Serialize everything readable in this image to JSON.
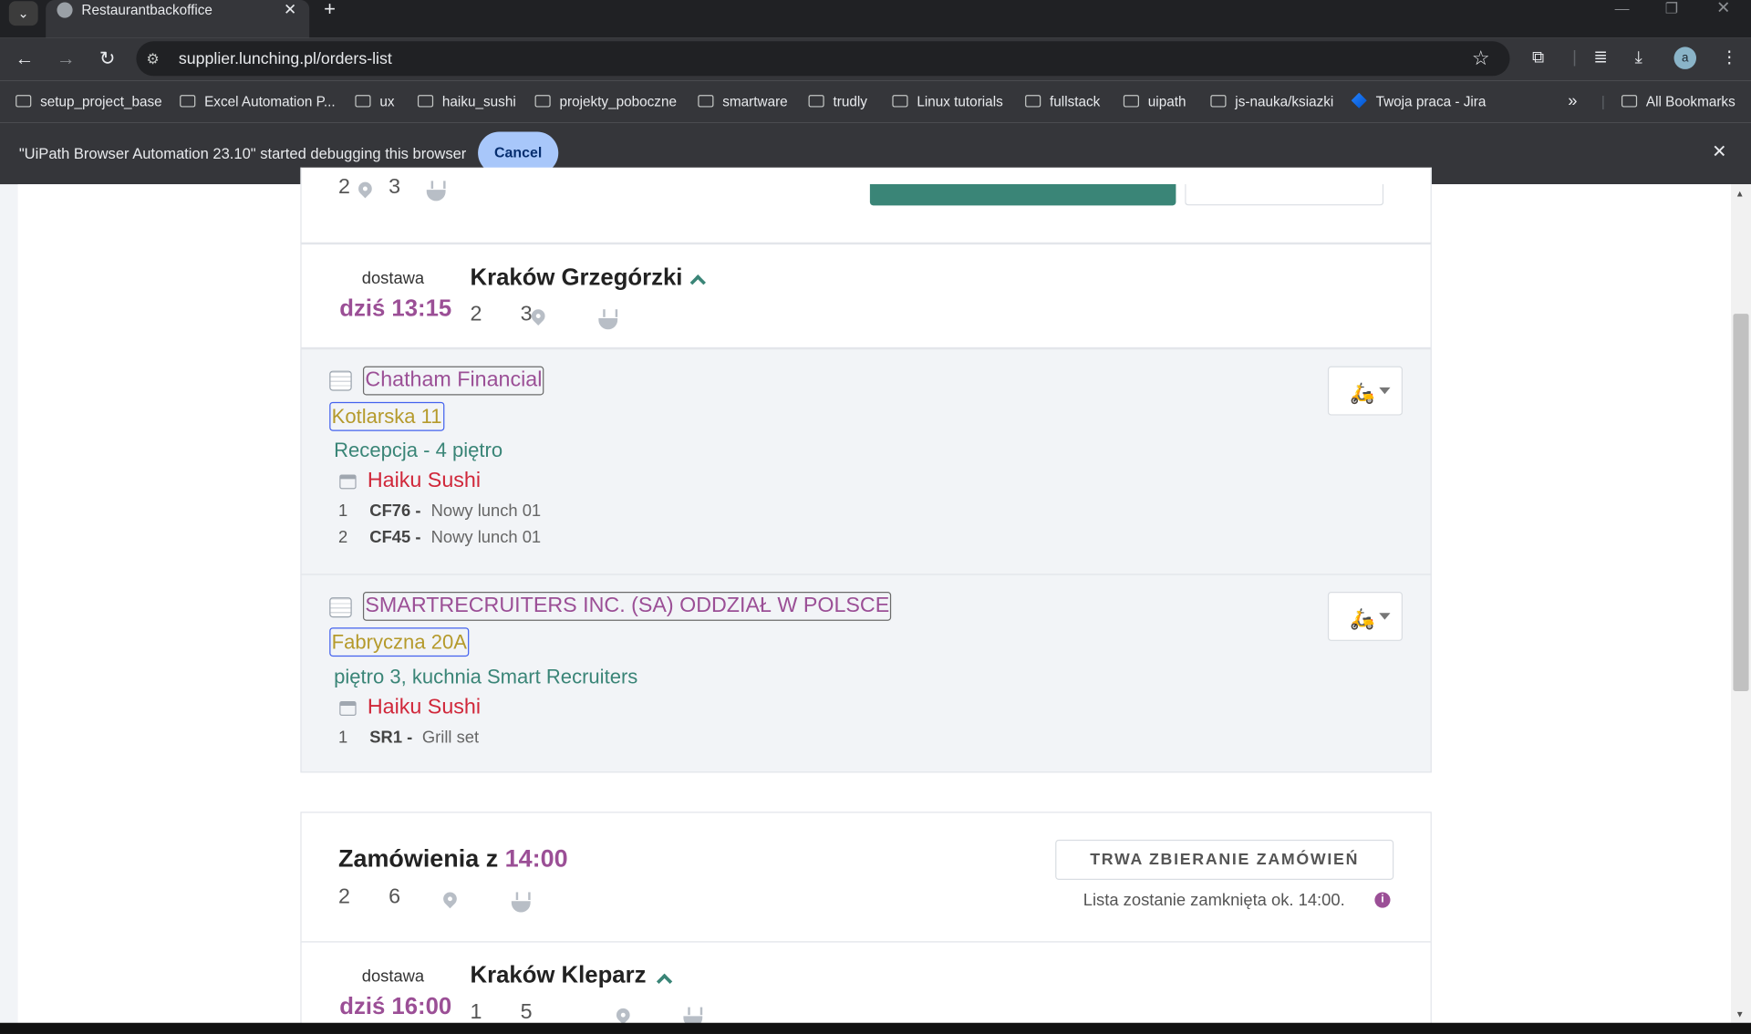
{
  "browser": {
    "tab_title": "Restaurantbackoffice",
    "url": "supplier.lunching.pl/orders-list",
    "avatar_letter": "a",
    "bookmarks": [
      "setup_project_base",
      "Excel Automation P...",
      "ux",
      "haiku_sushi",
      "projekty_poboczne",
      "smartware",
      "trudly",
      "Linux tutorials",
      "fullstack",
      "uipath",
      "js-nauka/ksiazki",
      "Twoja praca - Jira"
    ],
    "all_bookmarks": "All Bookmarks",
    "overflow": "»",
    "debug_message": "\"UiPath Browser Automation 23.10\" started debugging this browser",
    "cancel_label": "Cancel"
  },
  "top_partial": {
    "locations": "2",
    "meals": "3"
  },
  "delivery_groups": [
    {
      "label": "dostawa",
      "time": "dziś 13:15",
      "area": "Kraków Grzegórzki",
      "locations": "2",
      "meals": "3",
      "orders": [
        {
          "company": "Chatham Financial",
          "street": "Kotlarska 11",
          "place": "Recepcja - 4 piętro",
          "restaurant": "Haiku Sushi",
          "items": [
            {
              "qty": "1",
              "code": "CF76 -",
              "name": "Nowy lunch 01"
            },
            {
              "qty": "2",
              "code": "CF45 -",
              "name": "Nowy lunch 01"
            }
          ]
        },
        {
          "company": "SMARTRECRUITERS INC. (SA) ODDZIAŁ W POLSCE",
          "street": "Fabryczna 20A",
          "place": "piętro 3, kuchnia Smart Recruiters",
          "restaurant": "Haiku Sushi",
          "items": [
            {
              "qty": "1",
              "code": "SR1 -",
              "name": "Grill set"
            }
          ]
        }
      ]
    },
    {
      "label": "dostawa",
      "time": "dziś 16:00",
      "area": "Kraków Kleparz",
      "locations": "1",
      "meals": "5"
    }
  ],
  "batch": {
    "title_prefix": "Zamówienia z",
    "time": "14:00",
    "locations": "2",
    "meals": "6",
    "status_button": "TRWA ZBIERANIE ZAMÓWIEŃ",
    "status_note": "Lista zostanie zamknięta ok. 14:00."
  },
  "colors": {
    "purple": "#9b4f96",
    "teal": "#3a8577",
    "red": "#d0273a",
    "gold": "#b59a2c",
    "blue_outline": "#4361ee"
  }
}
